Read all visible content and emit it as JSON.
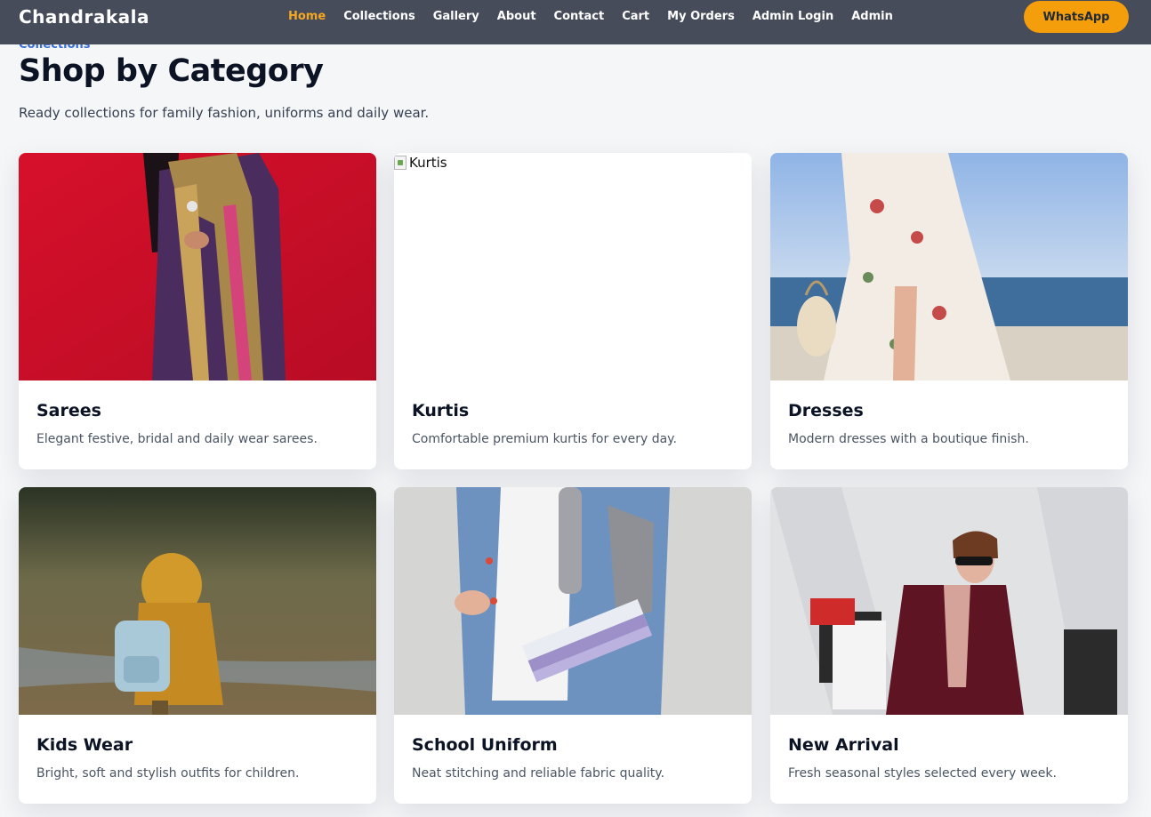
{
  "brand": "Chandrakala",
  "nav": [
    {
      "label": "Home",
      "active": true
    },
    {
      "label": "Collections"
    },
    {
      "label": "Gallery"
    },
    {
      "label": "About"
    },
    {
      "label": "Contact"
    },
    {
      "label": "Cart"
    },
    {
      "label": "My Orders"
    },
    {
      "label": "Admin Login"
    },
    {
      "label": "Admin"
    }
  ],
  "whatsapp_label": "WhatsApp",
  "section": {
    "eyebrow": "Collections",
    "title": "Shop by Category",
    "subtitle": "Ready collections for family fashion, uniforms and daily wear."
  },
  "categories": [
    {
      "name": "Sarees",
      "desc": "Elegant festive, bridal and daily wear sarees.",
      "image": "saree-photo"
    },
    {
      "name": "Kurtis",
      "desc": "Comfortable premium kurtis for every day.",
      "image_alt": "Kurtis",
      "image": "broken-image"
    },
    {
      "name": "Dresses",
      "desc": "Modern dresses with a boutique finish.",
      "image": "dress-photo"
    },
    {
      "name": "Kids Wear",
      "desc": "Bright, soft and stylish outfits for children.",
      "image": "kid-photo"
    },
    {
      "name": "School Uniform",
      "desc": "Neat stitching and reliable fabric quality.",
      "image": "student-photo"
    },
    {
      "name": "New Arrival",
      "desc": "Fresh seasonal styles selected every week.",
      "image": "shopping-photo"
    }
  ],
  "colors": {
    "header_bg": "#474c5a",
    "nav_active": "#f5a623",
    "whatsapp_bg": "#f59e0b",
    "eyebrow": "#3b6fd8"
  }
}
